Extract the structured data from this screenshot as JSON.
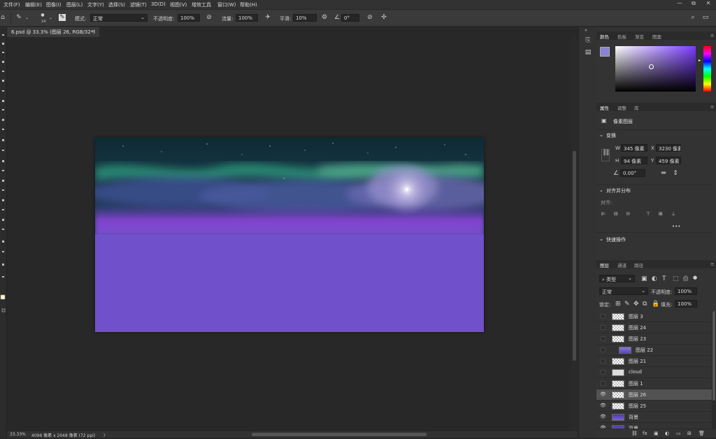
{
  "menu": [
    "文件(F)",
    "编辑(E)",
    "图像(I)",
    "图层(L)",
    "文字(Y)",
    "选择(S)",
    "滤镜(T)",
    "3D(D)",
    "视图(V)",
    "增效工具",
    "窗口(W)",
    "帮助(H)"
  ],
  "window_controls": [
    "—",
    "⧉",
    "✕"
  ],
  "options": {
    "brush_size": "14",
    "mode_label": "模式:",
    "mode_value": "正常",
    "opacity_label": "不透明度:",
    "opacity_value": "100%",
    "flow_label": "流量:",
    "flow_value": "100%",
    "smooth_label": "平滑:",
    "smooth_value": "10%",
    "angle_value": "0°"
  },
  "document": {
    "tab_title": "6.psd @ 33.3% (图层 26, RGB/32*)",
    "close": "×"
  },
  "status": {
    "zoom": "33.33%",
    "info": "4096 像素 x 2048 像素 (72 ppi)",
    "arrow": "〉"
  },
  "color_panel": {
    "tabs": [
      "颜色",
      "色板",
      "渐变",
      "图案"
    ],
    "fg_color": "#8b82d6",
    "bg_color": "#fff3c9",
    "hue_color": "#7a3cff"
  },
  "properties_panel": {
    "tabs": [
      "属性",
      "调整",
      "库"
    ],
    "layer_type": "像素图层",
    "transform_title": "变换",
    "w_label": "W",
    "w_value": "345 像素",
    "x_label": "X",
    "x_value": "3230 像素",
    "h_label": "H",
    "h_value": "94 像素",
    "y_label": "Y",
    "y_value": "459 像素",
    "angle_value": "0.00°",
    "align_title": "对齐并分布",
    "align_label": "对齐:",
    "more": "•••",
    "quick_title": "快速操作"
  },
  "layers_panel": {
    "tabs": [
      "图层",
      "通道",
      "路径"
    ],
    "filter_label": "类型",
    "blend_mode": "正常",
    "opacity_label": "不透明度:",
    "opacity_value": "100%",
    "lock_label": "锁定:",
    "fill_label": "填充:",
    "fill_value": "100%",
    "layers": [
      {
        "name": "图层 3",
        "visible": false,
        "selected": false
      },
      {
        "name": "图层 24",
        "visible": false,
        "selected": false
      },
      {
        "name": "图层 23",
        "visible": false,
        "selected": false
      },
      {
        "name": "图层 22",
        "visible": false,
        "selected": false
      },
      {
        "name": "图层 21",
        "visible": false,
        "selected": false
      },
      {
        "name": "cloud",
        "visible": false,
        "selected": false
      },
      {
        "name": "图层 1",
        "visible": false,
        "selected": false
      },
      {
        "name": "图层 26",
        "visible": true,
        "selected": true
      },
      {
        "name": "图层 25",
        "visible": true,
        "selected": false
      },
      {
        "name": "背景",
        "visible": true,
        "selected": false
      },
      {
        "name": "背景",
        "visible": true,
        "selected": false
      }
    ],
    "footer_icons": [
      "link-icon",
      "fx-icon",
      "mask-icon",
      "adjustment-icon",
      "group-icon",
      "new-layer-icon",
      "trash-icon"
    ],
    "footer_glyphs": [
      "⛓",
      "fx",
      "▣",
      "◐",
      "▭",
      "⊞",
      "🗑"
    ]
  }
}
